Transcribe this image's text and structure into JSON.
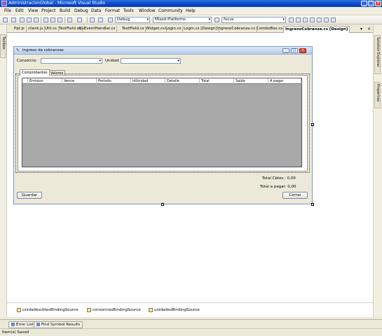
{
  "window": {
    "title": "AdministracionGlobal - Microsoft Visual Studio",
    "min_glyph": "_",
    "max_glyph": "□",
    "close_glyph": "×"
  },
  "menu": [
    "File",
    "Edit",
    "View",
    "Project",
    "Build",
    "Debug",
    "Data",
    "Format",
    "Tools",
    "Window",
    "Community",
    "Help"
  ],
  "toolbar": {
    "configuration": "Debug",
    "platform": "Mixed Platforms",
    "find_value": "focus"
  },
  "left_sidebar": {
    "toolbox_label": "Toolbox"
  },
  "right_sidebar": {
    "solution_explorer_label": "Solution Explorer",
    "properties_label": "Properties"
  },
  "doc_tabs": [
    "Ppr.js",
    "client.js",
    "Util.cs",
    "TextField.cs",
    "QuEventHandler.cs",
    "TextField.cs",
    "Widget.cs",
    "Login.cs",
    "Login.cs [Design]",
    "IngresoCobranza.cs",
    "ComboBox.cs",
    "IngresoCobranza.cs [Design]"
  ],
  "doc_controls": {
    "dropdown": "▾",
    "close": "×"
  },
  "form": {
    "title": "Ingreso de cobranzas",
    "consorcio_label": "Consorcio:",
    "unidad_label": "Unidad",
    "tabs": [
      "Comprobantes",
      "Valores"
    ],
    "grid_columns": [
      "Emision",
      "Vence",
      "Periodo",
      "IdUnidad",
      "Detalle",
      "Total",
      "Saldo",
      "A pagar"
    ],
    "total_cbtes": "Total Cbtes : 0,00",
    "total_pagar": "Total a pagar: 0,00",
    "guardar_button": "Guardar",
    "cerrar_button": "Cerrar"
  },
  "tray": [
    "unidadescbtesBindingSource",
    "consorciosBindingSource",
    "unidadesBindingSource"
  ],
  "bottom_tabs": [
    "Error List",
    "Find Symbol Results"
  ],
  "status": "Item(s) Saved",
  "colors": {
    "titlebar": "#0a47c8",
    "grid_background": "#a9a9a9",
    "form_close": "#d8462a"
  }
}
